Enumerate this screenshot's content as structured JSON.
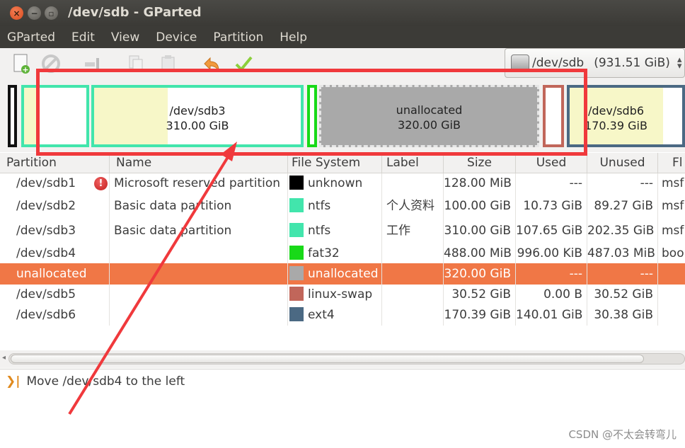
{
  "window": {
    "title": "/dev/sdb - GParted"
  },
  "menu": [
    "GParted",
    "Edit",
    "View",
    "Device",
    "Partition",
    "Help"
  ],
  "toolbar": {
    "buttons": [
      "new-icon",
      "delete-icon",
      "resize-move-icon",
      "copy-icon",
      "paste-icon",
      "undo-icon",
      "apply-icon"
    ]
  },
  "device": {
    "name": "/dev/sdb",
    "size": "(931.51 GiB)"
  },
  "diskmap": {
    "sdb3": {
      "name": "/dev/sdb3",
      "size": "310.00 GiB"
    },
    "unallocated": {
      "name": "unallocated",
      "size": "320.00 GiB"
    },
    "sdb6": {
      "name": "/dev/sdb6",
      "size": "170.39 GiB"
    }
  },
  "table": {
    "headers": {
      "partition": "Partition",
      "name": "Name",
      "filesystem": "File System",
      "label": "Label",
      "size": "Size",
      "used": "Used",
      "unused": "Unused",
      "flags": "Fl"
    },
    "rows": [
      {
        "partition": "/dev/sdb1",
        "name": "Microsoft reserved partition",
        "filesystem": "unknown",
        "fs_color": "#000000",
        "label": "",
        "size": "128.00 MiB",
        "used": "---",
        "unused": "---",
        "flags": "msf"
      },
      {
        "partition": "/dev/sdb2",
        "name": "Basic data partition",
        "filesystem": "ntfs",
        "fs_color": "#42e5ac",
        "label": "个人资料",
        "size": "100.00 GiB",
        "used": "10.73 GiB",
        "unused": "89.27 GiB",
        "flags": "msf"
      },
      {
        "partition": "/dev/sdb3",
        "name": "Basic data partition",
        "filesystem": "ntfs",
        "fs_color": "#42e5ac",
        "label": "工作",
        "size": "310.00 GiB",
        "used": "107.65 GiB",
        "unused": "202.35 GiB",
        "flags": "msf"
      },
      {
        "partition": "/dev/sdb4",
        "name": "",
        "filesystem": "fat32",
        "fs_color": "#18d918",
        "label": "",
        "size": "488.00 MiB",
        "used": "996.00 KiB",
        "unused": "487.03 MiB",
        "flags": "boo"
      },
      {
        "partition": "unallocated",
        "name": "",
        "filesystem": "unallocated",
        "fs_color": "#a9a9a9",
        "label": "",
        "size": "320.00 GiB",
        "used": "---",
        "unused": "---",
        "flags": ""
      },
      {
        "partition": "/dev/sdb5",
        "name": "",
        "filesystem": "linux-swap",
        "fs_color": "#c1665a",
        "label": "",
        "size": "30.52 GiB",
        "used": "0.00 B",
        "unused": "30.52 GiB",
        "flags": ""
      },
      {
        "partition": "/dev/sdb6",
        "name": "",
        "filesystem": "ext4",
        "fs_color": "#4b6983",
        "label": "",
        "size": "170.39 GiB",
        "used": "140.01 GiB",
        "unused": "30.38 GiB",
        "flags": ""
      }
    ]
  },
  "operations": {
    "item": "Move /dev/sdb4 to the left"
  },
  "watermark": "CSDN @不太会转弯儿",
  "colors": {
    "selected_row": "#f07746",
    "annotation": "#f0393c",
    "ntfs": "#42e5ac",
    "fat32": "#18d918",
    "swap": "#c1665a",
    "ext4": "#4b6983",
    "unallocated": "#a9a9a9"
  }
}
